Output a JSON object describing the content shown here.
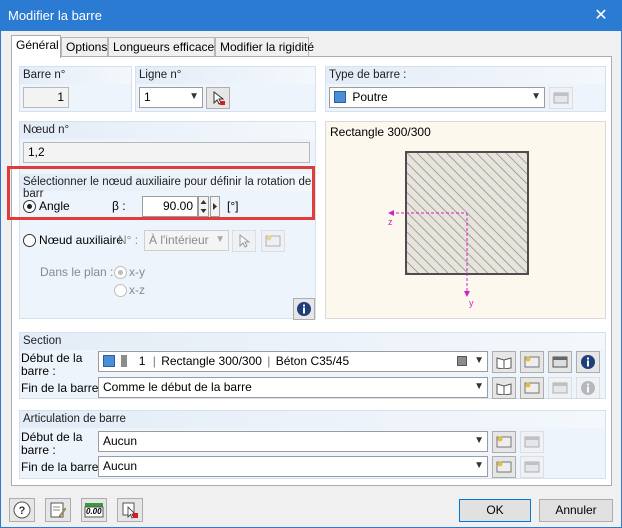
{
  "window": {
    "title": "Modifier la barre",
    "close_glyph": "✕"
  },
  "tabs": [
    {
      "label": "Général",
      "active": true
    },
    {
      "label": "Options"
    },
    {
      "label": "Longueurs efficaces"
    },
    {
      "label": "Modifier la rigidité"
    }
  ],
  "member": {
    "header": "Barre n°",
    "value": "1"
  },
  "line": {
    "header": "Ligne n°",
    "value": "1"
  },
  "member_type": {
    "header": "Type de barre :",
    "value": "Poutre",
    "color": "#4a90d9"
  },
  "node": {
    "header": "Nœud n°",
    "value": "1,2"
  },
  "rotation": {
    "header": "Sélectionner le nœud auxiliaire pour définir la rotation de barr",
    "angle_label": "Angle",
    "beta_label": "β :",
    "beta_value": "90.00",
    "unit": "[°]",
    "aux_node_label": "Nœud auxiliaire",
    "n_label": "N° :",
    "inside_value": "À l'intérieur",
    "plane_label": "Dans le plan :",
    "opt_xy": "x-y",
    "opt_xz": "x-z",
    "highlight_color": "#e03c3c"
  },
  "preview": {
    "title": "Rectangle 300/300",
    "axis_z": "z",
    "axis_y": "y",
    "axis_color": "#d020c8"
  },
  "section": {
    "header": "Section",
    "start_label_1": "Début de la",
    "start_label_2": "barre :",
    "start_number": "1",
    "start_name": "Rectangle 300/300",
    "start_material": "Béton C35/45",
    "end_label": "Fin de la barre :",
    "end_value": "Comme le début de la barre"
  },
  "hinge": {
    "header": "Articulation de barre",
    "start_label_1": "Début de la",
    "start_label_2": "barre :",
    "start_value": "Aucun",
    "end_label": "Fin de la barre :",
    "end_value": "Aucun"
  },
  "footer": {
    "ok": "OK",
    "cancel": "Annuler",
    "value_icon_text": "0.00"
  }
}
